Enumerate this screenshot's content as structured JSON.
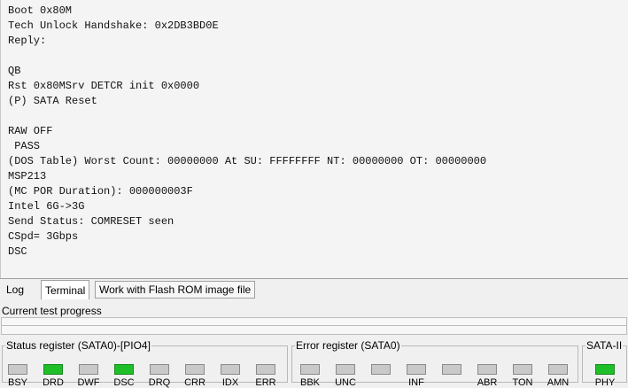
{
  "terminal": {
    "lines": [
      "Boot 0x80M",
      "Tech Unlock Handshake: 0x2DB3BD0E",
      "Reply:",
      "",
      "QB",
      "Rst 0x80MSrv DETCR init 0x0000",
      "(P) SATA Reset",
      "",
      "RAW OFF",
      " PASS",
      "(DOS Table) Worst Count: 00000000 At SU: FFFFFFFF NT: 00000000 OT: 00000000",
      "MSP213",
      "(MC POR Duration): 000000003F",
      "Intel 6G->3G",
      "Send Status: COMRESET seen",
      "CSpd= 3Gbps",
      "DSC"
    ]
  },
  "tabs": [
    {
      "label": "Log",
      "active": false
    },
    {
      "label": "Terminal",
      "active": true
    },
    {
      "label": "Work with Flash ROM image file",
      "active": false
    }
  ],
  "progress": {
    "label": "Current test progress",
    "value": 0
  },
  "status_register": {
    "title": "Status register (SATA0)-[PIO4]",
    "leds": [
      {
        "label": "BSY",
        "on": false
      },
      {
        "label": "DRD",
        "on": true
      },
      {
        "label": "DWF",
        "on": false
      },
      {
        "label": "DSC",
        "on": true
      },
      {
        "label": "DRQ",
        "on": false
      },
      {
        "label": "CRR",
        "on": false
      },
      {
        "label": "IDX",
        "on": false
      },
      {
        "label": "ERR",
        "on": false
      }
    ]
  },
  "error_register": {
    "title": "Error register (SATA0)",
    "leds": [
      {
        "label": "BBK",
        "on": false
      },
      {
        "label": "UNC",
        "on": false
      },
      {
        "label": "",
        "on": false
      },
      {
        "label": "INF",
        "on": false
      },
      {
        "label": "",
        "on": false
      },
      {
        "label": "ABR",
        "on": false
      },
      {
        "label": "TON",
        "on": false
      },
      {
        "label": "AMN",
        "on": false
      }
    ]
  },
  "sata_register": {
    "title": "SATA-II",
    "leds": [
      {
        "label": "PHY",
        "on": true
      }
    ]
  },
  "colors": {
    "led_on": "#1fbf2a",
    "led_off": "#c9c9c9"
  }
}
